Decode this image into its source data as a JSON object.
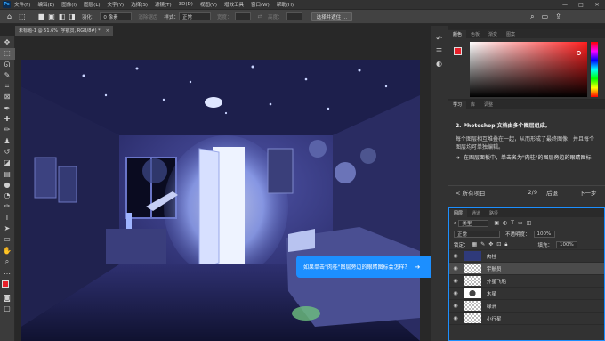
{
  "app": {
    "logo": "Ps"
  },
  "menu": [
    "文件(F)",
    "编辑(E)",
    "图像(I)",
    "图层(L)",
    "文字(Y)",
    "选择(S)",
    "滤镜(T)",
    "3D(D)",
    "视图(V)",
    "增效工具",
    "窗口(W)",
    "帮助(H)"
  ],
  "window_controls": {
    "minimize": "—",
    "maximize": "□",
    "close": "✕"
  },
  "options": {
    "feather_label": "羽化：",
    "feather_value": "0 像素",
    "antialias_label": "消除锯齿",
    "style_label": "样式：",
    "style_value": "正常",
    "width_label": "宽度：",
    "height_label": "高度：",
    "select_mask_button": "选择并遮住 ..."
  },
  "document": {
    "tab_title": "未标题-1 @ 51.6% (宇航员, RGB/8#) *",
    "close": "×"
  },
  "callout": {
    "text": "如果单击\"肉桂\"图层旁边的眼睛图标会怎样？",
    "arrow": "➔"
  },
  "panels": {
    "color": {
      "tabs": [
        "颜色",
        "色板",
        "渐变",
        "图案"
      ],
      "accent": "#e8202a"
    },
    "learn": {
      "tabs": [
        "学习",
        "库",
        "调整"
      ],
      "title": "2. Photoshop 文档由多个图层组成。",
      "body": "每个图层相互堆叠在一起，从而形成了最终图像，并且每个图层均可单独编辑。",
      "step_bullet": "➔",
      "step": "在图层面板中，单击名为\"肉桂\"的图层旁边的眼睛图标",
      "nav": {
        "all_projects": "< 所有项目",
        "page": "2/9",
        "prev": "后退",
        "next": "下一步"
      }
    },
    "layers": {
      "tabs": [
        "图层",
        "通道",
        "路径"
      ],
      "filter_kind": "类型",
      "blend_mode": "正常",
      "opacity_label": "不透明度：",
      "opacity_value": "100%",
      "lock_label": "锁定：",
      "fill_label": "填充：",
      "fill_value": "100%",
      "rows": [
        {
          "name": "肉桂",
          "selected": false
        },
        {
          "name": "宇航员",
          "selected": true
        },
        {
          "name": "外星飞船",
          "selected": false
        },
        {
          "name": "木星",
          "selected": false
        },
        {
          "name": "绿洲",
          "selected": false
        },
        {
          "name": "小行星",
          "selected": false
        }
      ]
    }
  },
  "side_icons": [
    "history-icon",
    "properties-icon",
    "adjust-icon"
  ]
}
